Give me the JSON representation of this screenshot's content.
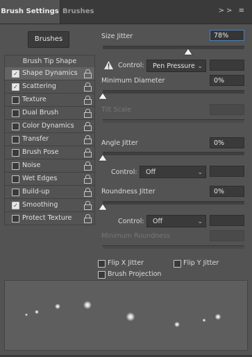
{
  "tabs": [
    {
      "label": "Brush Settings",
      "active": true
    },
    {
      "label": "Brushes",
      "active": false
    }
  ],
  "tab_icons": {
    "expand": ">>",
    "menu": "≡"
  },
  "brushes_button": "Brushes",
  "brush_tip_shape": "Brush Tip Shape",
  "sections": [
    {
      "label": "Shape Dynamics",
      "checked": true,
      "active": true,
      "locked": true
    },
    {
      "label": "Scattering",
      "checked": true,
      "active": false,
      "locked": true
    },
    {
      "label": "Texture",
      "checked": false,
      "active": false,
      "locked": true
    },
    {
      "label": "Dual Brush",
      "checked": false,
      "active": false,
      "locked": true
    },
    {
      "label": "Color Dynamics",
      "checked": false,
      "active": false,
      "locked": true
    },
    {
      "label": "Transfer",
      "checked": false,
      "active": false,
      "locked": true
    },
    {
      "label": "Brush Pose",
      "checked": false,
      "active": false,
      "locked": true
    },
    {
      "label": "Noise",
      "checked": false,
      "active": false,
      "locked": true
    },
    {
      "label": "Wet Edges",
      "checked": false,
      "active": false,
      "locked": true
    },
    {
      "label": "Build-up",
      "checked": false,
      "active": false,
      "locked": true
    },
    {
      "label": "Smoothing",
      "checked": true,
      "active": false,
      "locked": true
    },
    {
      "label": "Protect Texture",
      "checked": false,
      "active": false,
      "locked": true
    }
  ],
  "size_jitter": {
    "label": "Size Jitter",
    "value": "78%",
    "level": 0.78
  },
  "control_1": {
    "label": "Control:",
    "value": "Pen Pressure",
    "warning": true
  },
  "minimum_diameter": {
    "label": "Minimum Diameter",
    "value": "0%",
    "level": 0.0
  },
  "tilt_scale": {
    "label": "Tilt Scale",
    "disabled": true
  },
  "angle_jitter": {
    "label": "Angle Jitter",
    "value": "0%",
    "level": 0.0
  },
  "control_2": {
    "label": "Control:",
    "value": "Off"
  },
  "roundness_jitter": {
    "label": "Roundness Jitter",
    "value": "0%",
    "level": 0.0
  },
  "control_3": {
    "label": "Control:",
    "value": "Off"
  },
  "minimum_roundness": {
    "label": "Minimum Roundness",
    "disabled": true
  },
  "flip_x": {
    "label": "Flip X Jitter",
    "checked": false
  },
  "flip_y": {
    "label": "Flip Y Jitter",
    "checked": false
  },
  "brush_projection": {
    "label": "Brush Projection",
    "checked": false
  },
  "colors": {
    "panel": "#535353",
    "dark": "#3a3a3a",
    "highlight": "#4d7fb8"
  }
}
